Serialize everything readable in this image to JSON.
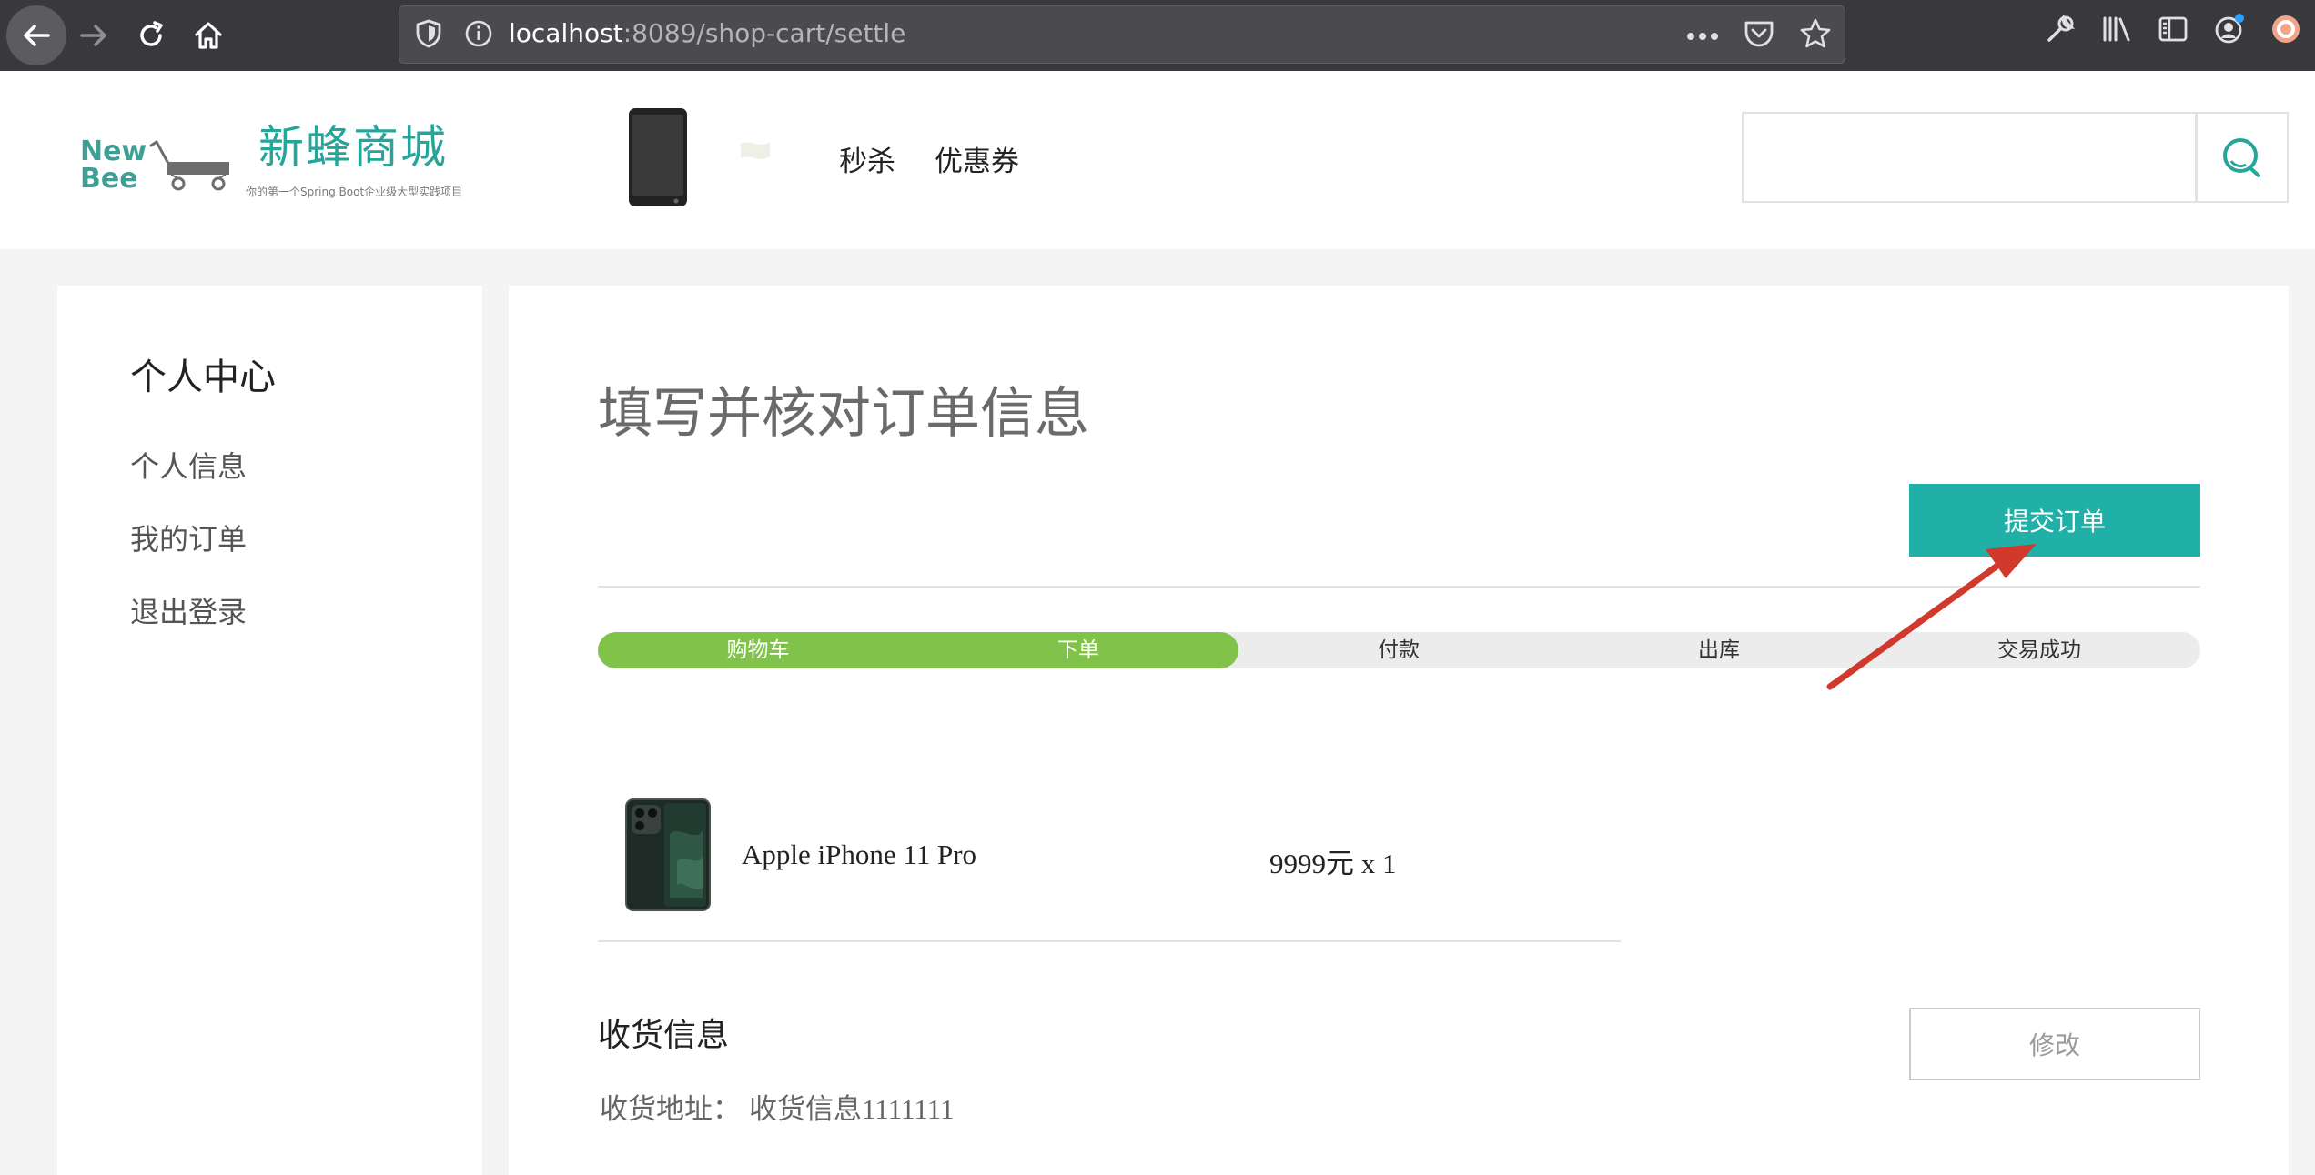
{
  "browser": {
    "url_host": "localhost",
    "url_path": ":8089/shop-cart/settle"
  },
  "site": {
    "logo_mark": "New Bee",
    "logo_title": "新蜂商城",
    "logo_tagline": "你的第一个Spring Boot企业级大型实践项目",
    "nav": {
      "seckill": "秒杀",
      "coupon": "优惠券"
    },
    "search_value": ""
  },
  "sidebar": {
    "title": "个人中心",
    "items": [
      {
        "label": "个人信息"
      },
      {
        "label": "我的订单"
      },
      {
        "label": "退出登录"
      }
    ]
  },
  "main": {
    "title": "填写并核对订单信息",
    "submit_label": "提交订单",
    "progress": {
      "steps": [
        {
          "label": "购物车",
          "done": true
        },
        {
          "label": "下单",
          "done": true
        },
        {
          "label": "付款",
          "done": false
        },
        {
          "label": "出库",
          "done": false
        },
        {
          "label": "交易成功",
          "done": false
        }
      ],
      "completed_steps": 2
    },
    "item": {
      "name": "Apple iPhone 11 Pro",
      "price_qty": "9999元 x 1"
    },
    "shipping": {
      "title": "收货信息",
      "edit_label": "修改",
      "address_label": "收货地址：",
      "address_value": "收货信息1111111"
    }
  },
  "colors": {
    "brand": "#26a69a",
    "submit": "#20b0a8",
    "progress_done": "#80c24a",
    "annotation": "#d0392b"
  }
}
